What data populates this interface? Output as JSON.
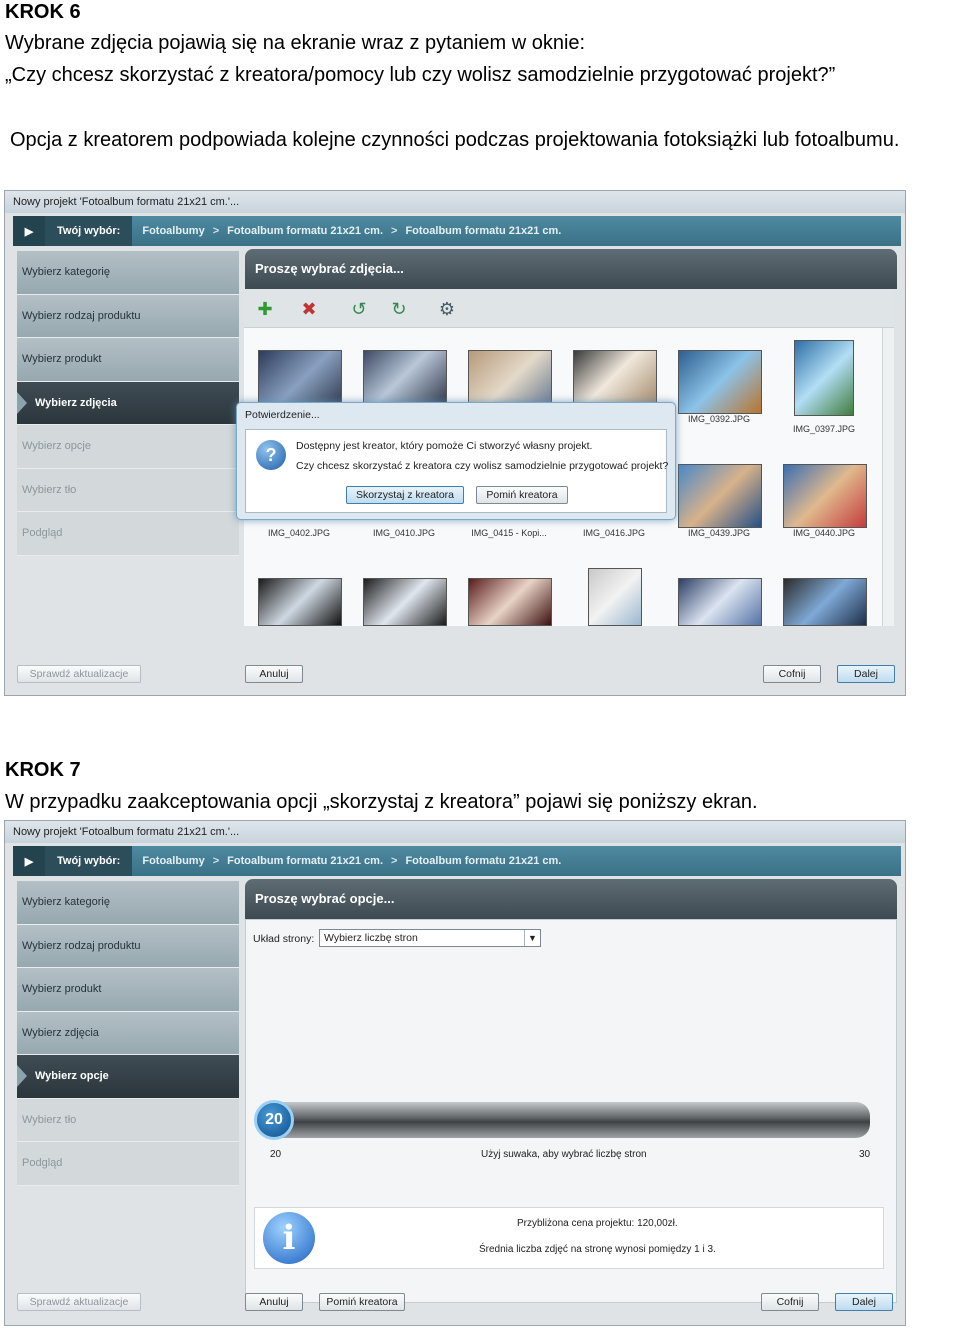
{
  "step6": {
    "heading": "KROK 6",
    "line1": "Wybrane zdjęcia pojawią się na ekranie wraz z pytaniem w oknie:",
    "line2": "„Czy chcesz skorzystać z kreatora/pomocy lub czy wolisz samodzielnie przygotować projekt?”",
    "line3": "Opcja z kreatorem podpowiada kolejne czynności podczas projektowania fotoksiążki lub fotoalbumu."
  },
  "step7": {
    "heading": "KROK 7",
    "line1": "W przypadku zaakceptowania opcji „skorzystaj z kreatora” pojawi się poniższy ekran."
  },
  "window": {
    "title": "Nowy projekt 'Fotoalbum formatu 21x21 cm.'...",
    "breadcrumb_first": "Twój wybór:",
    "breadcrumb_items": [
      "Fotoalbumy",
      "Fotoalbum formatu 21x21 cm.",
      "Fotoalbum formatu 21x21 cm."
    ],
    "breadcrumb_sep": ">",
    "sidebar": [
      "Wybierz kategorię",
      "Wybierz rodzaj produktu",
      "Wybierz produkt",
      "Wybierz zdjęcia",
      "Wybierz opcje",
      "Wybierz tło",
      "Podgląd"
    ],
    "update_button": "Sprawdź aktualizacje",
    "cancel_button": "Anuluj",
    "back_button": "Cofnij",
    "next_button": "Dalej",
    "skip_button": "Pomiń kreatora"
  },
  "screen1": {
    "panel_title": "Proszę wybrać zdjęcia...",
    "photo_labels": [
      "IMG_0392.JPG",
      "IMG_0397.JPG",
      "IMG_0402.JPG",
      "IMG_0410.JPG",
      "IMG_0415 - Kopi...",
      "IMG_0416.JPG",
      "IMG_0439.JPG",
      "IMG_0440.JPG"
    ],
    "dialog": {
      "title": "Potwierdzenie...",
      "line1": "Dostępny jest kreator, który pomoże Ci stworzyć własny projekt.",
      "line2": "Czy chcesz skorzystać z kreatora czy wolisz samodzielnie przygotować projekt?",
      "use_wizard": "Skorzystaj z kreatora",
      "skip_wizard": "Pomiń kreatora"
    }
  },
  "screen2": {
    "panel_title": "Proszę wybrać opcje...",
    "layout_label": "Układ strony:",
    "layout_select": "Wybierz liczbę stron",
    "slider_value": "20",
    "slider_min": "20",
    "slider_max": "30",
    "slider_hint": "Użyj suwaka, aby wybrać liczbę stron",
    "price_text": "Przybliżona cena projektu: 120,00zł.",
    "avg_text": "Średnia liczba zdjęć na stronę wynosi pomiędzy 1 i 3."
  },
  "colors": {
    "breadcrumb": "#3a7187",
    "active_step": "#2b363c",
    "slider_knob": "#0c4f8c"
  }
}
